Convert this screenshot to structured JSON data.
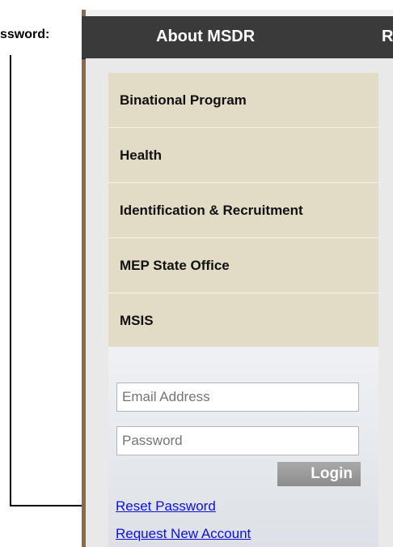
{
  "annotation": {
    "label": "ssword:"
  },
  "topnav": {
    "items": [
      "About MSDR",
      "R"
    ]
  },
  "menu": {
    "items": [
      "Binational Program",
      "Health",
      "Identification & Recruitment",
      "MEP State Office",
      "MSIS"
    ]
  },
  "login": {
    "email_placeholder": "Email Address",
    "password_placeholder": "Password",
    "button_label": "Login"
  },
  "links": {
    "reset_password": "Reset Password",
    "request_account": "Request New Account"
  },
  "colors": {
    "nav_bg": "#3a3a3a",
    "menu_bg": "#e2dcc7",
    "link": "#1010d8",
    "edge": "#8a6a4a"
  }
}
